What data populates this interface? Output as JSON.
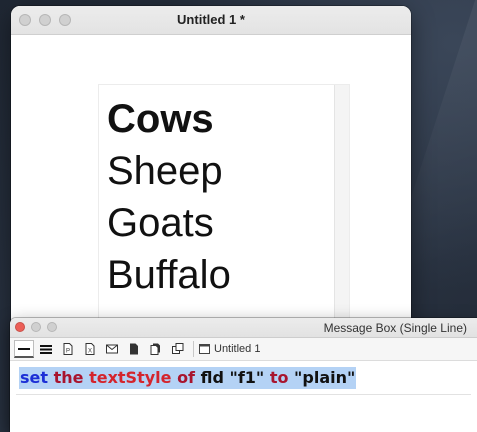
{
  "stack_window": {
    "title": "Untitled 1 *"
  },
  "field": {
    "lines": [
      {
        "text": "Cows",
        "style": "bold"
      },
      {
        "text": "Sheep",
        "style": "plain"
      },
      {
        "text": "Goats",
        "style": "plain"
      },
      {
        "text": "Buffalo",
        "style": "plain"
      }
    ]
  },
  "message_box": {
    "title": "Message Box (Single Line)",
    "toolbar": {
      "tools": [
        "single-line-icon",
        "multi-line-icon",
        "global-properties-icon",
        "global-variables-icon",
        "pending-messages-icon",
        "front-scripts-icon",
        "back-scripts-icon",
        "message-path-icon"
      ],
      "stack_tab_label": "Untitled 1"
    },
    "command": {
      "tokens": [
        {
          "text": "set",
          "color": "#1c2fd6"
        },
        {
          "text": " ",
          "color": "#000000"
        },
        {
          "text": "the",
          "color": "#a8142e"
        },
        {
          "text": " ",
          "color": "#000000"
        },
        {
          "text": "textStyle",
          "color": "#d4242c"
        },
        {
          "text": " ",
          "color": "#000000"
        },
        {
          "text": "of",
          "color": "#a8142e"
        },
        {
          "text": " ",
          "color": "#000000"
        },
        {
          "text": "fld",
          "color": "#111111"
        },
        {
          "text": " ",
          "color": "#000000"
        },
        {
          "text": "\"f1\"",
          "color": "#111111"
        },
        {
          "text": " ",
          "color": "#000000"
        },
        {
          "text": "to",
          "color": "#a8142e"
        },
        {
          "text": " ",
          "color": "#000000"
        },
        {
          "text": "\"plain\"",
          "color": "#111111"
        }
      ]
    }
  },
  "colors": {
    "selection_highlight": "#b4d2f5",
    "close_button": "#ec5f57"
  }
}
